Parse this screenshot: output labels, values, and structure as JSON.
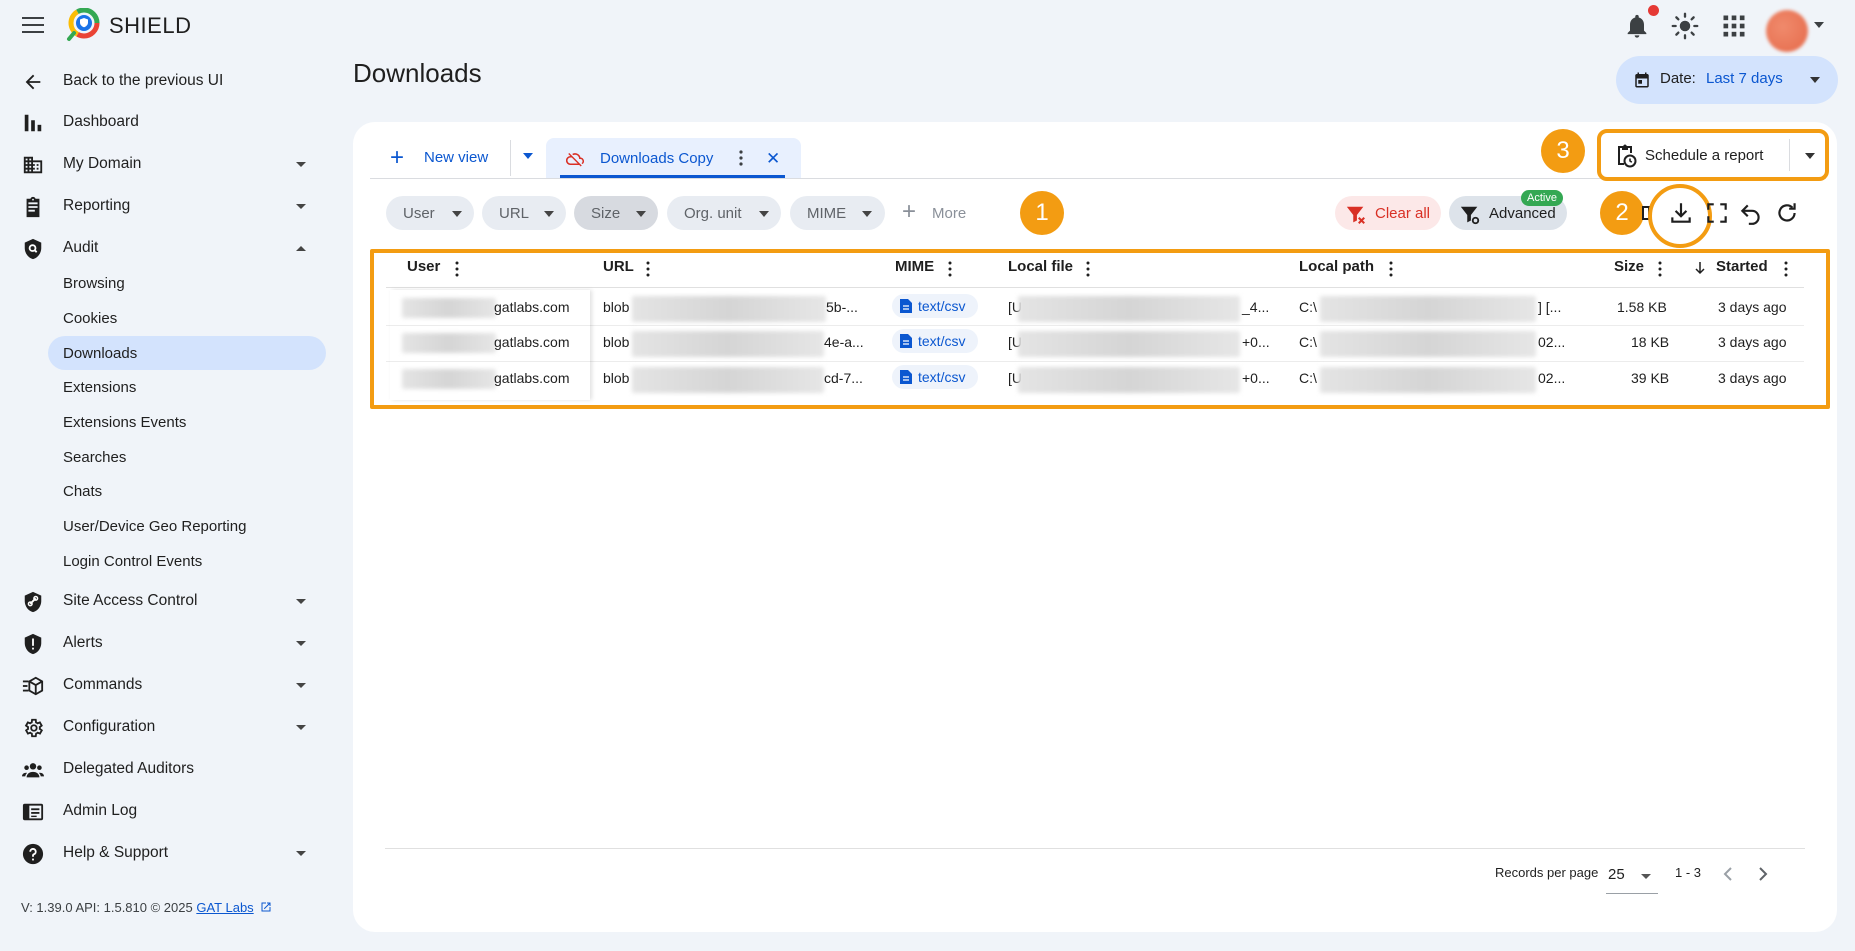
{
  "app": {
    "brand": "SHIELD"
  },
  "sidebar": {
    "back_label": "Back to the previous UI",
    "items": [
      {
        "label": "Dashboard",
        "icon": "bar-chart-icon"
      },
      {
        "label": "My Domain",
        "icon": "domain-icon"
      },
      {
        "label": "Reporting",
        "icon": "clipboard-icon"
      },
      {
        "label": "Audit",
        "icon": "shield-search-icon"
      },
      {
        "label": "Site Access Control",
        "icon": "shield-link-icon"
      },
      {
        "label": "Alerts",
        "icon": "alert-shield-icon"
      },
      {
        "label": "Commands",
        "icon": "commands-icon"
      },
      {
        "label": "Configuration",
        "icon": "gear-icon"
      },
      {
        "label": "Delegated Auditors",
        "icon": "group-icon"
      },
      {
        "label": "Admin Log",
        "icon": "log-icon"
      },
      {
        "label": "Help & Support",
        "icon": "help-icon"
      }
    ],
    "audit_sub": [
      "Browsing",
      "Cookies",
      "Downloads",
      "Extensions",
      "Extensions Events",
      "Searches",
      "Chats",
      "User/Device Geo Reporting",
      "Login Control Events"
    ],
    "footer_version": "V: 1.39.0  API: 1.5.810  © 2025 ",
    "footer_link": "GAT Labs"
  },
  "page": {
    "title": "Downloads",
    "date_label": "Date:",
    "date_value": "Last 7 days"
  },
  "tabs": {
    "new_view": "New view",
    "active_tab": "Downloads Copy"
  },
  "schedule_label": "Schedule a report",
  "filters": {
    "chips": [
      "User",
      "URL",
      "Size",
      "Org. unit",
      "MIME"
    ],
    "more": "More",
    "clear_all": "Clear all",
    "advanced": "Advanced",
    "advanced_badge": "Active"
  },
  "callouts": [
    "1",
    "2",
    "3"
  ],
  "table": {
    "columns": [
      "User",
      "URL",
      "MIME",
      "Local file",
      "Local path",
      "Size",
      "Started"
    ],
    "rows": [
      {
        "user": "gatlabs.com",
        "url_start": "blob",
        "url_end": "5b-...",
        "mime": "text/csv",
        "file_start": "[U",
        "file_end": "_4...",
        "path_start": "C:\\",
        "path_end": "] [...",
        "size": "1.58 KB",
        "started": "3 days ago"
      },
      {
        "user": "gatlabs.com",
        "url_start": "blob",
        "url_end": "4e-a...",
        "mime": "text/csv",
        "file_start": "[U",
        "file_end": "+0...",
        "path_start": "C:\\",
        "path_end": "02...",
        "size": "18 KB",
        "started": "3 days ago"
      },
      {
        "user": "gatlabs.com",
        "url_start": "blob",
        "url_end": "cd-7...",
        "mime": "text/csv",
        "file_start": "[U",
        "file_end": "+0...",
        "path_start": "C:\\",
        "path_end": "02...",
        "size": "39 KB",
        "started": "3 days ago"
      }
    ]
  },
  "pager": {
    "rpp_label": "Records per page",
    "rpp_value": "25",
    "range": "1 - 3"
  },
  "colors": {
    "accent": "#0b57d0",
    "callout": "#f39c12",
    "active_nav": "#d3e3fd",
    "danger": "#d93025",
    "success": "#34a853"
  }
}
